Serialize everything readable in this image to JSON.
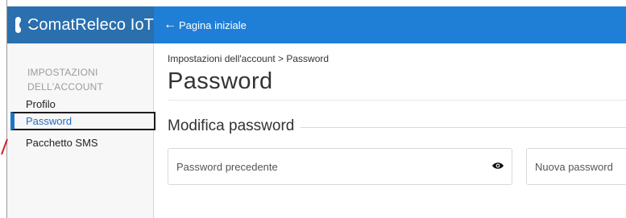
{
  "brand": {
    "title": "ComatReleco IoT",
    "logo_icon": "comatreleco-logo-icon"
  },
  "topbar": {
    "home_label": "Pagina iniziale",
    "back_icon": "arrow-left-icon"
  },
  "sidebar": {
    "section_title_line1": "IMPOSTAZIONI",
    "section_title_line2": "DELL'ACCOUNT",
    "items": [
      {
        "label": "Profilo"
      },
      {
        "label": "Password",
        "active": true
      },
      {
        "label": "Pacchetto SMS"
      }
    ]
  },
  "main": {
    "breadcrumb": "Impostazioni dell'account > Password",
    "title": "Password",
    "section_title": "Modifica password",
    "fields": {
      "old_password_placeholder": "Password precedente",
      "new_password_placeholder": "Nuova password"
    }
  },
  "colors": {
    "brand_blue": "#2a6fae",
    "topbar_blue": "#1f7fd6",
    "active_item": "#1f6fc4",
    "annotation_red": "#d0202a"
  }
}
